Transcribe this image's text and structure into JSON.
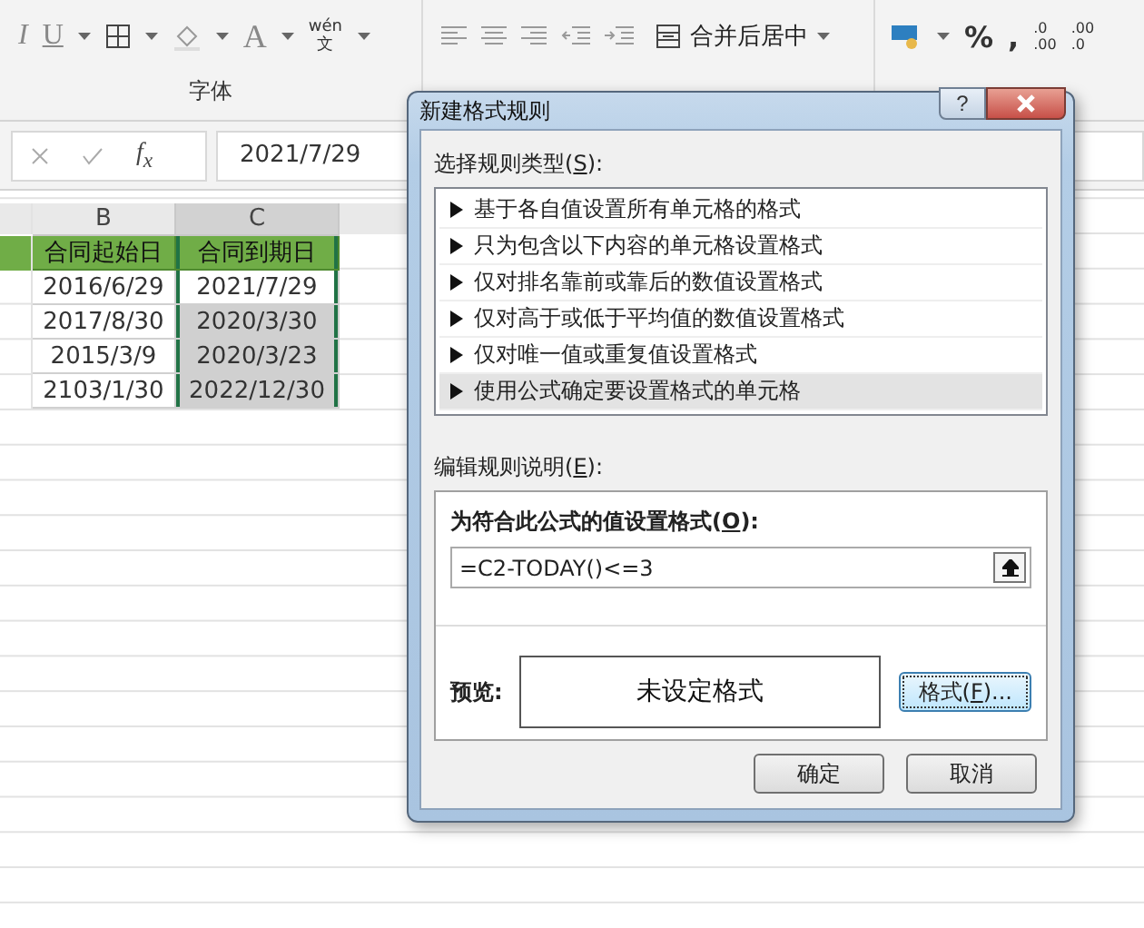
{
  "ribbon": {
    "font_group": {
      "label": "字体",
      "italic": "I",
      "underline": "U",
      "font_color": "A",
      "phonetic_top": "wén",
      "phonetic_bottom": "文"
    },
    "merge_button": {
      "label": "合并后居中"
    },
    "number_group": {
      "percent": "%",
      "comma": ",",
      "increase_decimal": {
        "top": ".0",
        "bottom": ".00"
      },
      "decrease_decimal": {
        "top": ".00",
        "bottom": ".0"
      }
    }
  },
  "formula_bar": {
    "fx": "f$_{x}$",
    "value": "2021/7/29"
  },
  "sheet": {
    "columns": [
      {
        "label": "B",
        "selected": false
      },
      {
        "label": "C",
        "selected": true
      }
    ],
    "rows": [
      {
        "kind": "header",
        "cells": [
          "合同起始日",
          "合同到期日"
        ]
      },
      {
        "kind": "data",
        "cells": [
          "2016/6/29",
          "2021/7/29"
        ],
        "shaded": false
      },
      {
        "kind": "data",
        "cells": [
          "2017/8/30",
          "2020/3/30"
        ],
        "shaded": true
      },
      {
        "kind": "data",
        "cells": [
          "2015/3/9",
          "2020/3/23"
        ],
        "shaded": true
      },
      {
        "kind": "data",
        "cells": [
          "2103/1/30",
          "2022/12/30"
        ],
        "shaded": true
      }
    ]
  },
  "dialog": {
    "title": "新建格式规则",
    "help": "?",
    "rule_type_label": [
      "选择规则类型(",
      "S",
      "):"
    ],
    "rule_types": [
      {
        "label": "基于各自值设置所有单元格的格式",
        "selected": false
      },
      {
        "label": "只为包含以下内容的单元格设置格式",
        "selected": false
      },
      {
        "label": "仅对排名靠前或靠后的数值设置格式",
        "selected": false
      },
      {
        "label": "仅对高于或低于平均值的数值设置格式",
        "selected": false
      },
      {
        "label": "仅对唯一值或重复值设置格式",
        "selected": false
      },
      {
        "label": "使用公式确定要设置格式的单元格",
        "selected": true
      }
    ],
    "edit_label": [
      "编辑规则说明(",
      "E",
      "):"
    ],
    "formula_label": [
      "为符合此公式的值设置格式(",
      "O",
      "):"
    ],
    "formula": "=C2-TODAY()<=3",
    "preview_label": "预览:",
    "preview_text": "未设定格式",
    "format_button": [
      "格式(",
      "F",
      ")..."
    ],
    "buttons": [
      "确定",
      "取消"
    ]
  }
}
